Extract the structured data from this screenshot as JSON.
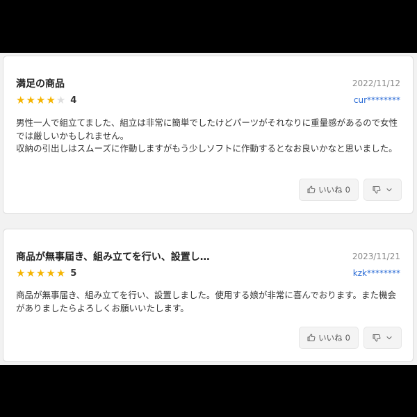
{
  "reviews": [
    {
      "title": "満足の商品",
      "date": "2022/11/12",
      "rating": 4,
      "rating_label": "4",
      "user": "cur********",
      "paragraphs": [
        "男性一人で組立てました、組立は非常に簡単でしたけどパーツがそれなりに重量感があるので女性では厳しいかもしれません。",
        "収納の引出しはスムーズに作動しますがもう少しソフトに作動するとなお良いかなと思いました。"
      ],
      "like_label": "いいね",
      "like_count": "0"
    },
    {
      "title": "商品が無事届き、組み立てを行い、設置し…",
      "date": "2023/11/21",
      "rating": 5,
      "rating_label": "5",
      "user": "kzk********",
      "paragraphs": [
        "商品が無事届き、組み立てを行い、設置しました。使用する娘が非常に喜んでおります。また機会がありましたらよろしくお願いいたします。"
      ],
      "like_label": "いいね",
      "like_count": "0"
    }
  ],
  "icons": {
    "like": "thumbs-up-icon",
    "dislike": "thumbs-down-icon",
    "expand": "chevron-down-icon",
    "star": "star-icon"
  },
  "colors": {
    "star_on": "#f5b400",
    "star_off": "#dddddd",
    "user_link": "#2a6bd6"
  }
}
